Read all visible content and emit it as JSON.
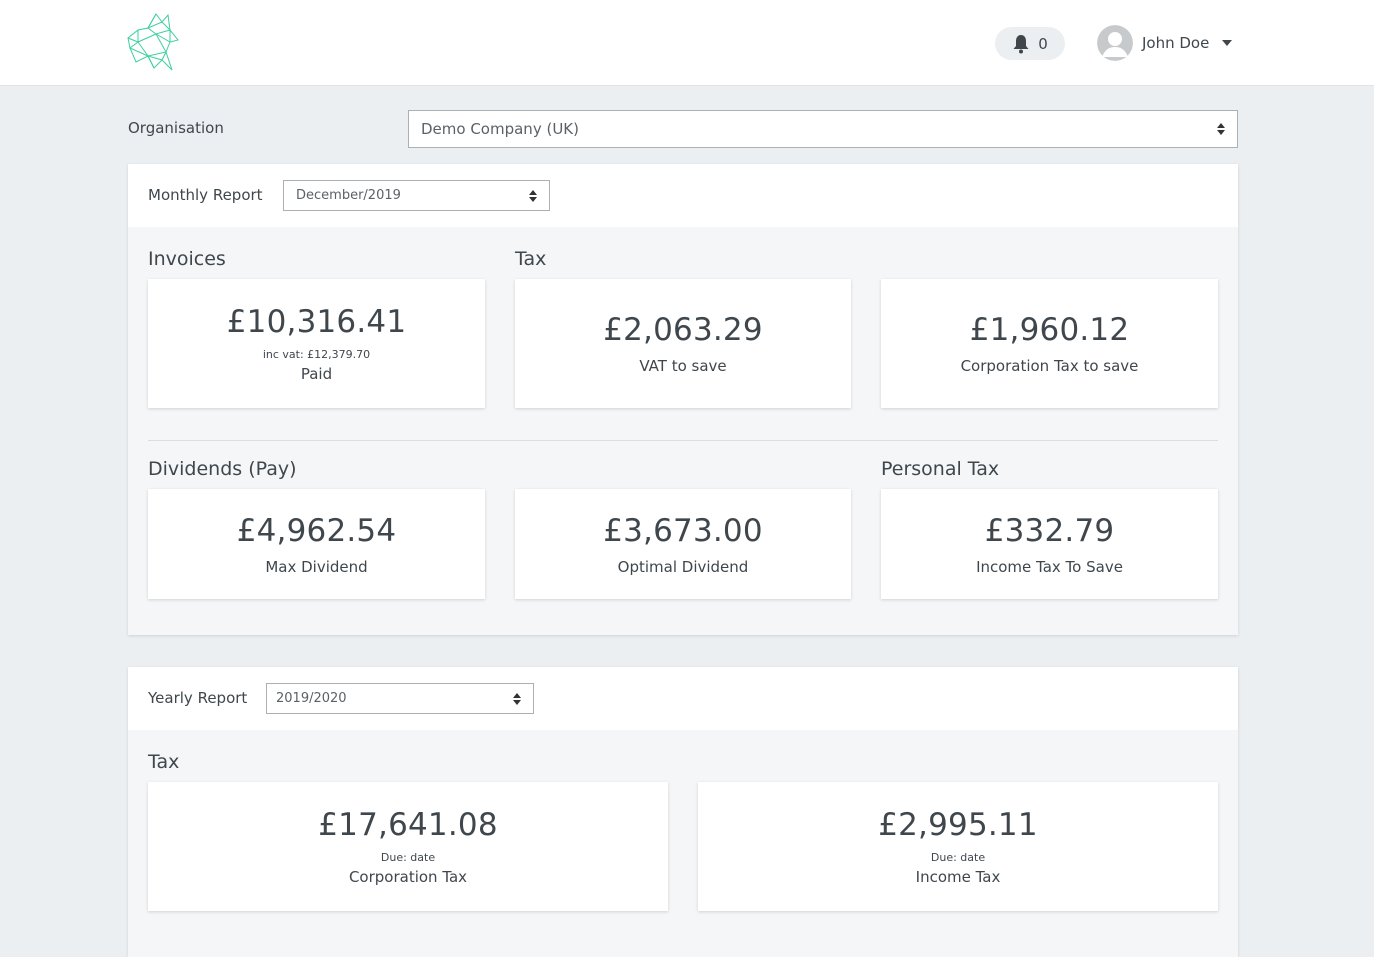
{
  "header": {
    "notifications_count": "0",
    "user_name": "John Doe",
    "brand_color": "#3ecfa0"
  },
  "organisation": {
    "label": "Organisation",
    "selected": "Demo Company (UK)"
  },
  "monthly": {
    "label": "Monthly Report",
    "selected": "December/2019",
    "invoices_title": "Invoices",
    "tax_title": "Tax",
    "dividends_title": "Dividends (Pay)",
    "personal_title": "Personal Tax",
    "cards": {
      "paid": {
        "amount": "£10,316.41",
        "sub": "inc vat: £12,379.70",
        "label": "Paid"
      },
      "vat": {
        "amount": "£2,063.29",
        "label": "VAT to save"
      },
      "corp": {
        "amount": "£1,960.12",
        "label": "Corporation Tax to save"
      },
      "max_div": {
        "amount": "£4,962.54",
        "label": "Max Dividend"
      },
      "opt_div": {
        "amount": "£3,673.00",
        "label": "Optimal Dividend"
      },
      "income": {
        "amount": "£332.79",
        "label": "Income Tax To Save"
      }
    }
  },
  "yearly": {
    "label": "Yearly Report",
    "selected": "2019/2020",
    "tax_title": "Tax",
    "cards": {
      "corp": {
        "amount": "£17,641.08",
        "sub": "Due: date",
        "label": "Corporation Tax"
      },
      "income": {
        "amount": "£2,995.11",
        "sub": "Due: date",
        "label": "Income Tax"
      }
    }
  }
}
